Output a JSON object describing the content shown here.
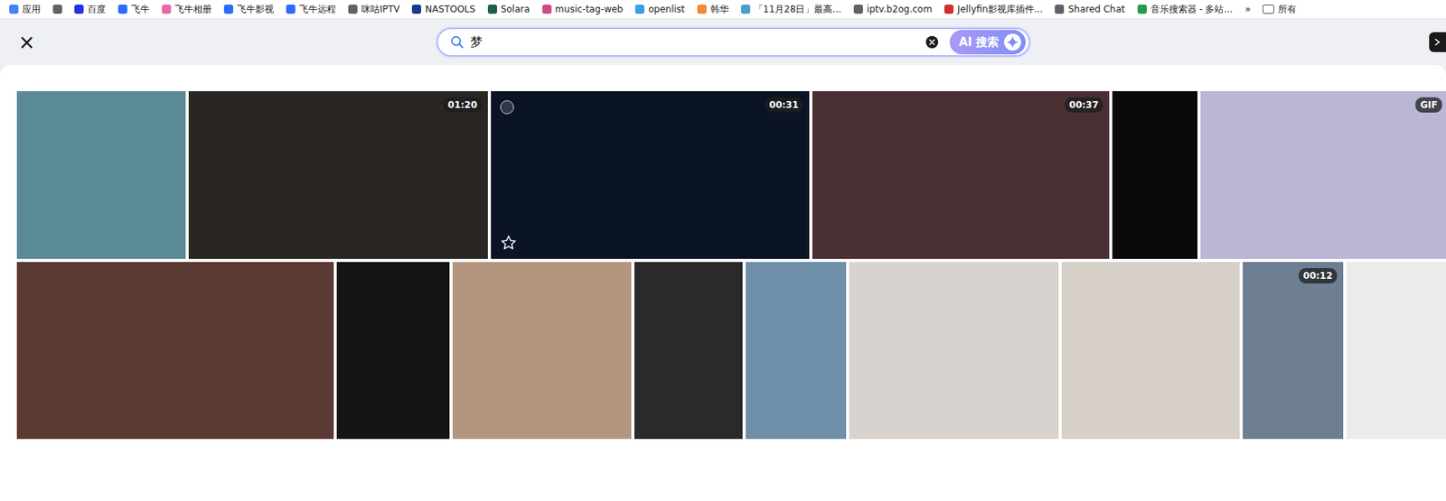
{
  "bookmarks_bar": {
    "items": [
      {
        "label": "应用",
        "color": "#4285f4"
      },
      {
        "label": "",
        "color": "#5f6368"
      },
      {
        "label": "百度",
        "color": "#2932e1"
      },
      {
        "label": "飞牛",
        "color": "#2f6bff"
      },
      {
        "label": "飞牛相册",
        "color": "#e86aa6"
      },
      {
        "label": "飞牛影视",
        "color": "#2f6bff"
      },
      {
        "label": "飞牛远程",
        "color": "#2f6bff"
      },
      {
        "label": "咪咕IPTV",
        "color": "#5f6368"
      },
      {
        "label": "NASTOOLS",
        "color": "#1a3a8a"
      },
      {
        "label": "Solara",
        "color": "#1f5f4a"
      },
      {
        "label": "music-tag-web",
        "color": "#d04a8a"
      },
      {
        "label": "openlist",
        "color": "#3aa0e0"
      },
      {
        "label": "韩华",
        "color": "#f08a3a"
      },
      {
        "label": "「11月28日」最高...",
        "color": "#4aa0c8"
      },
      {
        "label": "iptv.b2og.com",
        "color": "#5f6368"
      },
      {
        "label": "Jellyfin影视库插件...",
        "color": "#d03030"
      },
      {
        "label": "Shared Chat",
        "color": "#5f6368"
      },
      {
        "label": "音乐搜索器 - 多站...",
        "color": "#2a9a4a"
      }
    ],
    "overflow": "»",
    "all": "所有"
  },
  "close": "×",
  "search": {
    "query": "梦",
    "ai_button": "AI 搜索"
  },
  "rows": [
    [
      {
        "badge": "",
        "color": "#5a8a96",
        "hovered": false
      },
      {
        "badge": "01:20",
        "color": "#2a2622",
        "hovered": false
      },
      {
        "badge": "00:31",
        "color": "#0b1424",
        "hovered": true
      },
      {
        "badge": "00:37",
        "color": "#4a2f33",
        "hovered": false
      },
      {
        "badge": "",
        "color": "#0a0a0a",
        "hovered": false
      },
      {
        "badge": "GIF",
        "color": "#b9b6d6",
        "hovered": false
      }
    ],
    [
      {
        "badge": "",
        "color": "#5a3a33",
        "hovered": false
      },
      {
        "badge": "",
        "color": "#141414",
        "hovered": false
      },
      {
        "badge": "",
        "color": "#b49680",
        "hovered": false
      },
      {
        "badge": "",
        "color": "#2a2a2a",
        "hovered": false
      },
      {
        "badge": "",
        "color": "#6f8fa8",
        "hovered": false
      },
      {
        "badge": "",
        "color": "#d9d3cf",
        "hovered": false
      },
      {
        "badge": "",
        "color": "#d6d0c8",
        "hovered": false
      },
      {
        "badge": "00:12",
        "color": "#6e7f94",
        "hovered": false
      },
      {
        "badge": "",
        "color": "#ecebea",
        "hovered": false
      }
    ]
  ]
}
